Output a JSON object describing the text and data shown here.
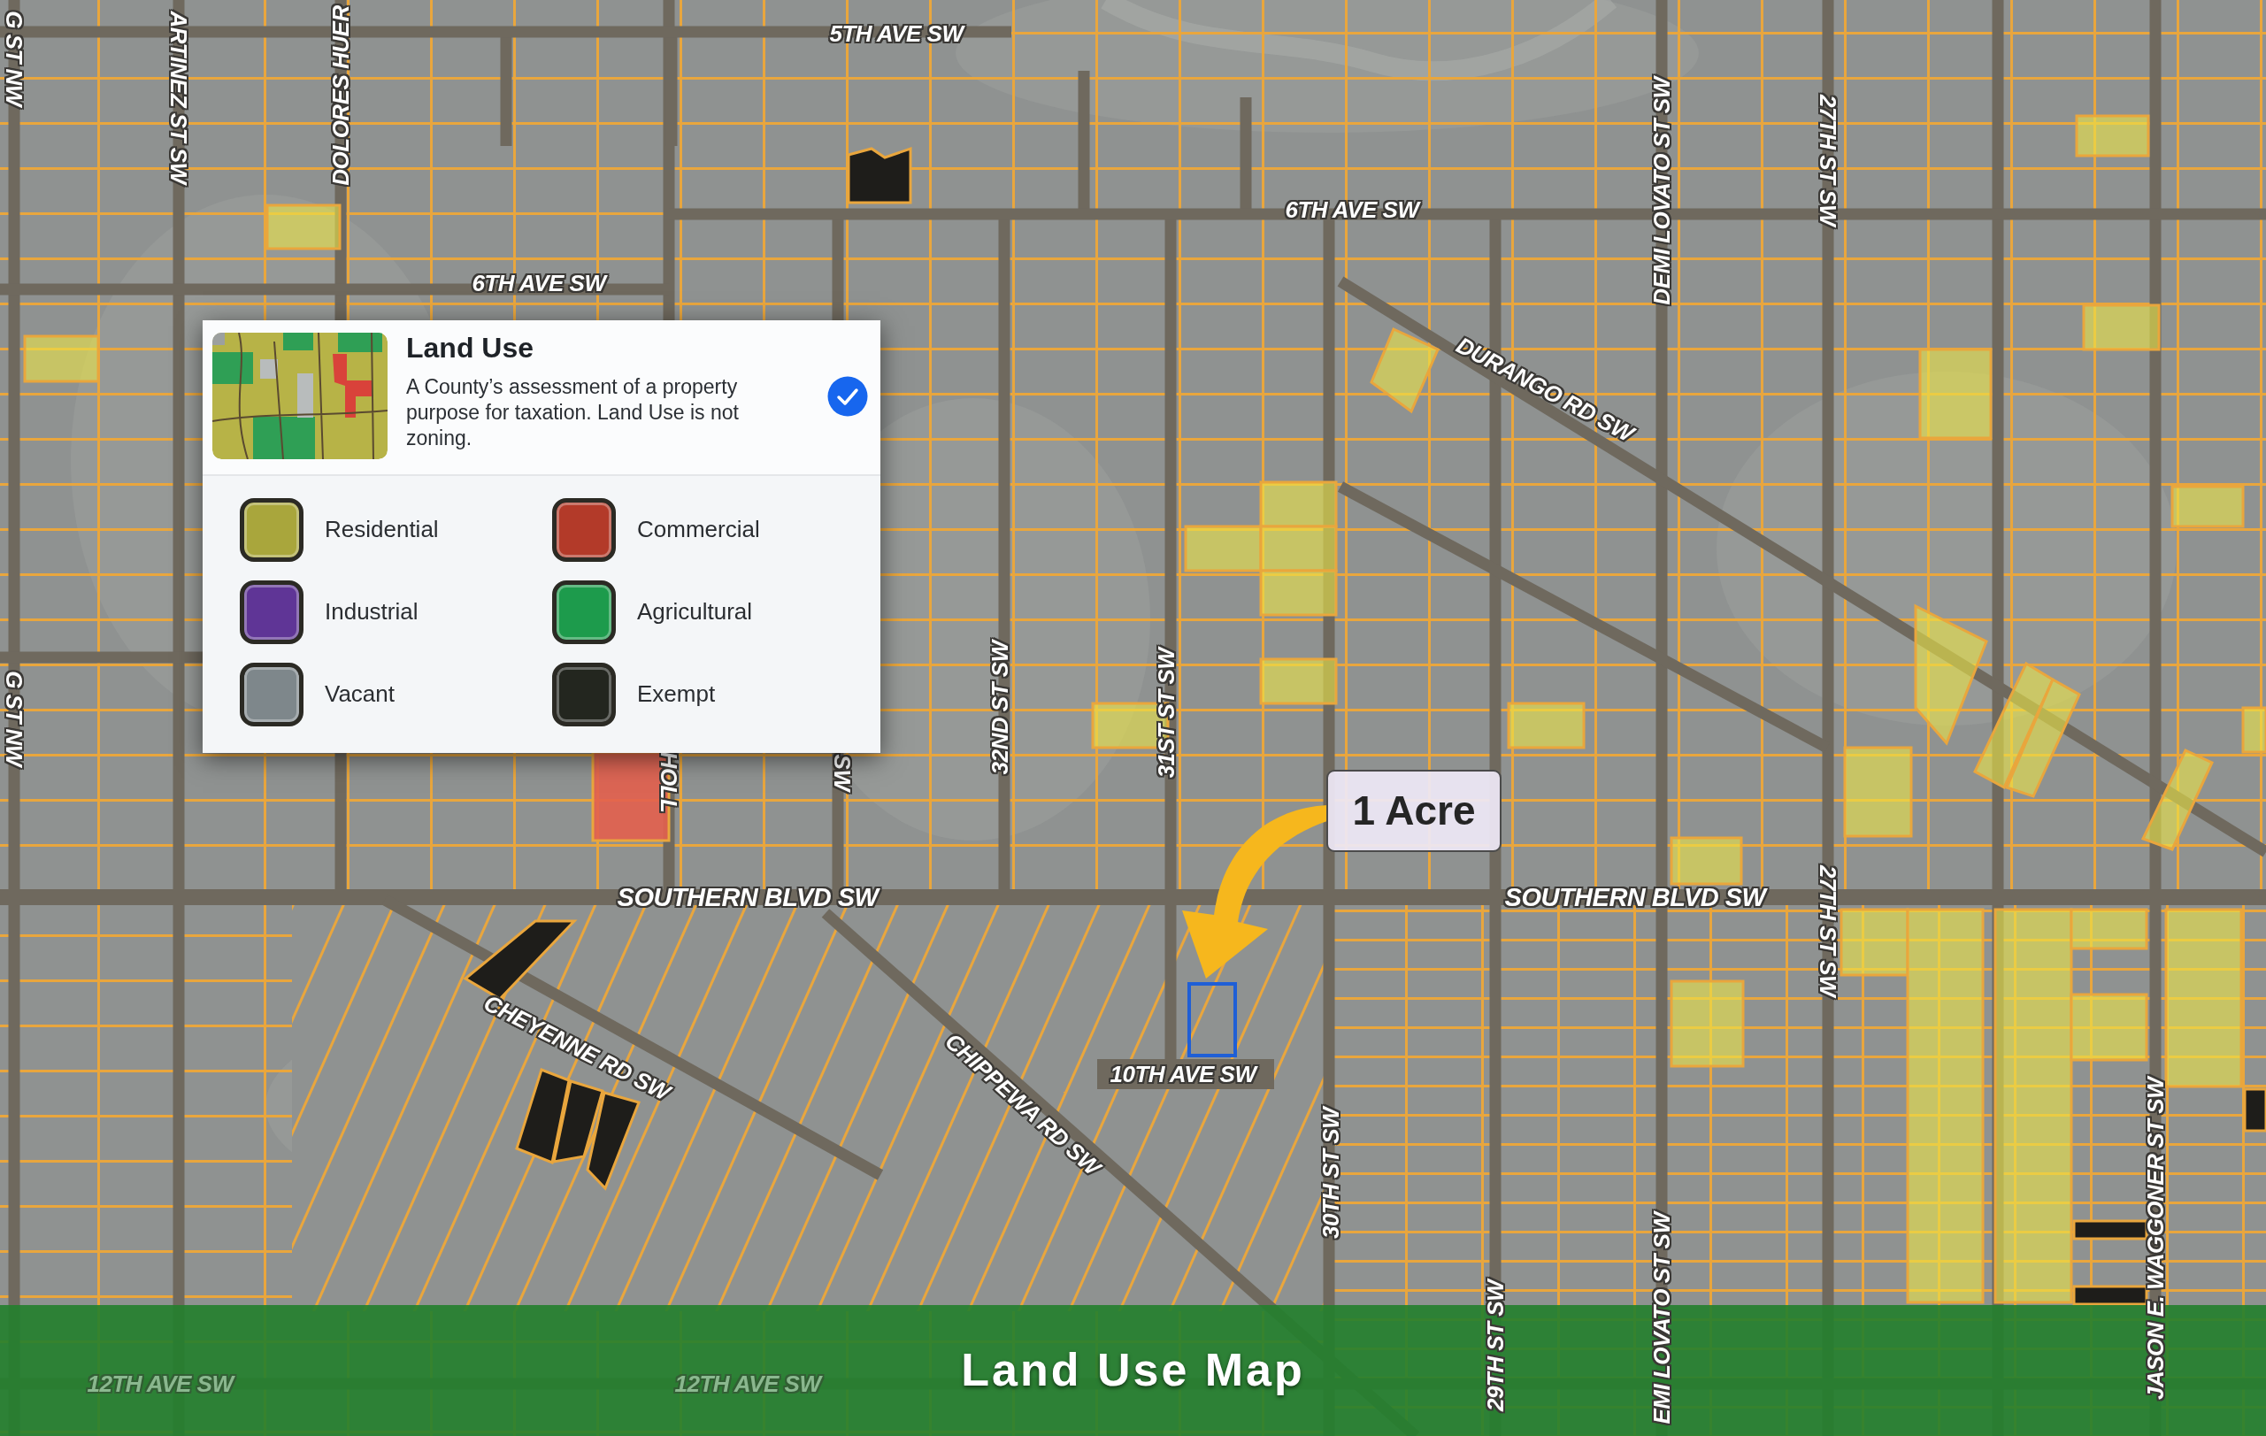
{
  "map": {
    "street_labels": [
      {
        "text": "G ST NW",
        "kind": "street"
      },
      {
        "text": "ARTINEZ ST SW",
        "kind": "street"
      },
      {
        "text": "DOLORES HUER",
        "kind": "street"
      },
      {
        "text": "5TH AVE SW",
        "kind": "street"
      },
      {
        "text": "DEMI LOVATO ST SW",
        "kind": "street"
      },
      {
        "text": "27TH ST SW",
        "kind": "street"
      },
      {
        "text": "6TH AVE SW",
        "kind": "street"
      },
      {
        "text": "6TH AVE SW",
        "kind": "street"
      },
      {
        "text": "DURANGO RD SW",
        "kind": "street"
      },
      {
        "text": "32ND ST SW",
        "kind": "street"
      },
      {
        "text": "31ST ST SW",
        "kind": "street"
      },
      {
        "text": "G ST NW",
        "kind": "street"
      },
      {
        "text": "HOLL",
        "kind": "street"
      },
      {
        "text": "SW",
        "kind": "street"
      },
      {
        "text": "27TH ST SW",
        "kind": "street"
      },
      {
        "text": "SOUTHERN BLVD SW",
        "kind": "boulevard"
      },
      {
        "text": "SOUTHERN BLVD SW",
        "kind": "boulevard"
      },
      {
        "text": "CHEYENNE RD SW",
        "kind": "street"
      },
      {
        "text": "10TH AVE SW",
        "kind": "street"
      },
      {
        "text": "CHIPPEWA RD SW",
        "kind": "street"
      },
      {
        "text": "30TH ST SW",
        "kind": "street"
      },
      {
        "text": "JASON E. WAGGONER ST SW",
        "kind": "street"
      },
      {
        "text": "29TH ST SW",
        "kind": "street"
      },
      {
        "text": "EMI LOVATO ST SW",
        "kind": "street"
      },
      {
        "text": "12TH AVE SW",
        "kind": "street"
      },
      {
        "text": "12TH AVE SW",
        "kind": "street"
      }
    ],
    "callout": {
      "text": "1 Acre"
    }
  },
  "legend": {
    "title": "Land Use",
    "description": "A County’s assessment of a property purpose for taxation. Land Use is not zoning.",
    "checked": true,
    "items": [
      {
        "label": "Residential",
        "color": "#a9a63c"
      },
      {
        "label": "Commercial",
        "color": "#b33a29"
      },
      {
        "label": "Industrial",
        "color": "#5f3596"
      },
      {
        "label": "Agricultural",
        "color": "#1d9b4c"
      },
      {
        "label": "Vacant",
        "color": "#7e878b"
      },
      {
        "label": "Exempt",
        "color": "#23261f"
      }
    ]
  },
  "banner": {
    "title": "Land Use Map"
  }
}
